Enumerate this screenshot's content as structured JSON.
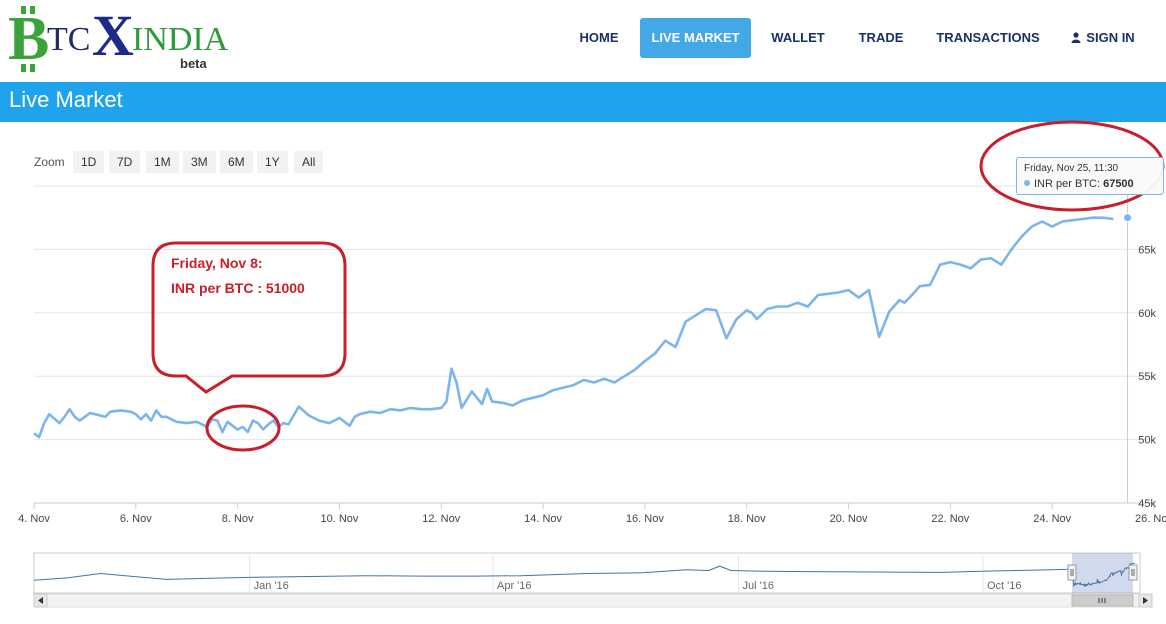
{
  "site": {
    "logo": {
      "b": "B",
      "tc": "TC",
      "x": "X",
      "india": "INDIA",
      "beta": "beta"
    },
    "nav": [
      {
        "label": "HOME",
        "active": false
      },
      {
        "label": "LIVE MARKET",
        "active": true
      },
      {
        "label": "WALLET",
        "active": false
      },
      {
        "label": "TRADE",
        "active": false
      },
      {
        "label": "TRANSACTIONS",
        "active": false
      },
      {
        "label": "SIGN IN",
        "active": false,
        "icon": "user-icon"
      }
    ],
    "page_title": "Live Market"
  },
  "zoom": {
    "label": "Zoom",
    "buttons": [
      "1D",
      "7D",
      "1M",
      "3M",
      "6M",
      "1Y",
      "All"
    ]
  },
  "tooltip": {
    "date": "Friday, Nov 25, 11:30",
    "series": "INR per BTC:",
    "value": "67500"
  },
  "annotation": {
    "line1": "Friday, Nov 8:",
    "line2": "INR per BTC : 51000"
  },
  "colors": {
    "series": "#7cb5ec",
    "accent": "#1fa3ec",
    "nav_active": "#42a8e6",
    "annotation": "#c8202a",
    "nav_text": "#1b2f6b"
  },
  "chart_data": {
    "type": "line",
    "ylabel": "",
    "xlabel": "",
    "ylim": [
      45000,
      70000
    ],
    "yticks": [
      45000,
      50000,
      55000,
      60000,
      65000
    ],
    "ytick_labels": [
      "45k",
      "50k",
      "55k",
      "60k",
      "65k"
    ],
    "xlim_days": [
      4,
      26
    ],
    "xticks": [
      {
        "day": 4,
        "label": "4. Nov"
      },
      {
        "day": 6,
        "label": "6. Nov"
      },
      {
        "day": 8,
        "label": "8. Nov"
      },
      {
        "day": 10,
        "label": "10. Nov"
      },
      {
        "day": 12,
        "label": "12. Nov"
      },
      {
        "day": 14,
        "label": "14. Nov"
      },
      {
        "day": 16,
        "label": "16. Nov"
      },
      {
        "day": 18,
        "label": "18. Nov"
      },
      {
        "day": 20,
        "label": "20. Nov"
      },
      {
        "day": 22,
        "label": "22. Nov"
      },
      {
        "day": 24,
        "label": "24. Nov"
      },
      {
        "day": 26,
        "label": "26. Nov"
      }
    ],
    "x": [
      4.0,
      4.1,
      4.2,
      4.3,
      4.5,
      4.6,
      4.7,
      4.8,
      4.9,
      5.0,
      5.1,
      5.2,
      5.4,
      5.5,
      5.7,
      5.9,
      6.0,
      6.1,
      6.2,
      6.3,
      6.4,
      6.5,
      6.6,
      6.8,
      7.0,
      7.2,
      7.4,
      7.5,
      7.6,
      7.7,
      7.8,
      7.9,
      8.0,
      8.1,
      8.2,
      8.3,
      8.4,
      8.5,
      8.6,
      8.7,
      8.8,
      8.9,
      9.0,
      9.2,
      9.4,
      9.6,
      9.8,
      10.0,
      10.2,
      10.3,
      10.4,
      10.6,
      10.8,
      11.0,
      11.2,
      11.4,
      11.6,
      11.8,
      12.0,
      12.1,
      12.2,
      12.3,
      12.4,
      12.6,
      12.8,
      12.9,
      13.0,
      13.2,
      13.4,
      13.6,
      13.8,
      14.0,
      14.2,
      14.4,
      14.6,
      14.8,
      15.0,
      15.2,
      15.4,
      15.6,
      15.8,
      16.0,
      16.2,
      16.4,
      16.6,
      16.8,
      17.0,
      17.2,
      17.4,
      17.6,
      17.8,
      18.0,
      18.1,
      18.2,
      18.3,
      18.4,
      18.6,
      18.8,
      19.0,
      19.2,
      19.4,
      19.6,
      19.8,
      20.0,
      20.2,
      20.4,
      20.6,
      20.8,
      21.0,
      21.1,
      21.2,
      21.4,
      21.6,
      21.8,
      22.0,
      22.2,
      22.4,
      22.6,
      22.8,
      23.0,
      23.2,
      23.4,
      23.6,
      23.8,
      24.0,
      24.2,
      24.4,
      24.6,
      24.8,
      25.0,
      25.2,
      25.4,
      25.6,
      25.8,
      26.0
    ],
    "series": [
      {
        "name": "INR per BTC",
        "values": [
          50500,
          50200,
          51300,
          52000,
          51300,
          51800,
          52400,
          51800,
          51500,
          51800,
          52100,
          52000,
          51800,
          52200,
          52300,
          52200,
          52000,
          51600,
          52000,
          51500,
          52300,
          51800,
          51800,
          51400,
          51300,
          51400,
          51000,
          51600,
          51500,
          50600,
          51400,
          51100,
          50800,
          51000,
          50600,
          51500,
          51300,
          50800,
          51200,
          51500,
          51000,
          51300,
          51200,
          52600,
          51900,
          51500,
          51300,
          51700,
          51100,
          51800,
          52000,
          52200,
          52100,
          52400,
          52300,
          52500,
          52400,
          52400,
          52500,
          53000,
          55600,
          54500,
          52500,
          53800,
          52800,
          54000,
          53000,
          52900,
          52700,
          53100,
          53300,
          53500,
          53900,
          54100,
          54300,
          54700,
          54500,
          54800,
          54500,
          55000,
          55500,
          56200,
          56800,
          57800,
          57300,
          59300,
          59800,
          60300,
          60200,
          58000,
          59500,
          60200,
          60000,
          59500,
          59900,
          60300,
          60500,
          60500,
          60800,
          60500,
          61400,
          61500,
          61600,
          61800,
          61200,
          61800,
          58100,
          60100,
          61000,
          60800,
          61200,
          62100,
          62200,
          63800,
          64000,
          63800,
          63500,
          64200,
          64300,
          63800,
          65000,
          66000,
          66800,
          67200,
          66800,
          67200,
          67300,
          67400,
          67500,
          67500,
          67400
        ]
      }
    ],
    "navigator": {
      "labels": [
        "Jan '16",
        "Apr '16",
        "Jul '16",
        "Oct '16"
      ]
    }
  }
}
